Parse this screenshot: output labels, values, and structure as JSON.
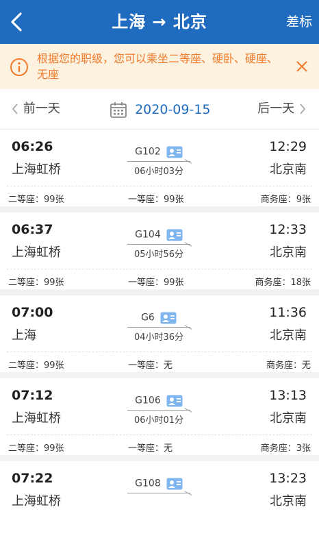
{
  "header": {
    "title": "上海 → 北京",
    "standard_label": "差标"
  },
  "notice": {
    "text": "根据您的职级，您可以乘坐二等座、硬卧、硬座、无座"
  },
  "datebar": {
    "prev_label": "前一天",
    "date": "2020-09-15",
    "next_label": "后一天"
  },
  "trains": [
    {
      "dep_time": "06:26",
      "dep_station": "上海虹桥",
      "code": "G102",
      "duration": "06小时03分",
      "arr_time": "12:29",
      "arr_station": "北京南",
      "seats": [
        "二等座：99张",
        "一等座：99张",
        "商务座：9张"
      ]
    },
    {
      "dep_time": "06:37",
      "dep_station": "上海虹桥",
      "code": "G104",
      "duration": "05小时56分",
      "arr_time": "12:33",
      "arr_station": "北京南",
      "seats": [
        "二等座：99张",
        "一等座：99张",
        "商务座：18张"
      ]
    },
    {
      "dep_time": "07:00",
      "dep_station": "上海",
      "code": "G6",
      "duration": "04小时36分",
      "arr_time": "11:36",
      "arr_station": "北京南",
      "seats": [
        "二等座：99张",
        "一等座：无",
        "商务座：无"
      ]
    },
    {
      "dep_time": "07:12",
      "dep_station": "上海虹桥",
      "code": "G106",
      "duration": "06小时01分",
      "arr_time": "13:13",
      "arr_station": "北京南",
      "seats": [
        "二等座：99张",
        "一等座：无",
        "商务座：3张"
      ]
    },
    {
      "dep_time": "07:22",
      "dep_station": "上海虹桥",
      "code": "G108",
      "duration": "",
      "arr_time": "13:23",
      "arr_station": "北京南",
      "seats": [
        "",
        "",
        ""
      ]
    }
  ],
  "colors": {
    "primary": "#1f6bc0",
    "notice_bg": "#fdf1e0",
    "notice_text": "#f07a2a"
  },
  "icons": {
    "back": "chevron-left-icon",
    "notice": "info-circle-icon",
    "close": "close-icon",
    "calendar": "calendar-icon",
    "id": "id-card-icon"
  }
}
